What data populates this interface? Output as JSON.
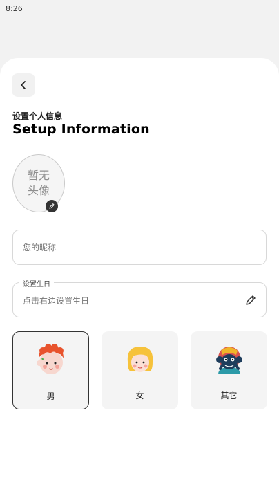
{
  "status_bar": {
    "time": "8:26"
  },
  "header": {
    "subtitle": "设置个人信息",
    "title": "Setup Information"
  },
  "avatar": {
    "placeholder_line1": "暂无",
    "placeholder_line2": "头像"
  },
  "nickname": {
    "placeholder": "您的昵称",
    "value": ""
  },
  "birthday": {
    "legend": "设置生日",
    "placeholder": "点击右边设置生日"
  },
  "gender": {
    "selected": "male",
    "options": [
      {
        "id": "male",
        "label": "男"
      },
      {
        "id": "female",
        "label": "女"
      },
      {
        "id": "other",
        "label": "其它"
      }
    ]
  },
  "icons": {
    "back": "chevron-left-icon",
    "avatar_edit": "pencil-icon",
    "birthday_edit": "pencil-icon"
  },
  "colors": {
    "sheet_background": "#ffffff",
    "page_background": "#f2f2f2",
    "card_background": "#f4f4f4",
    "selected_border": "#333333",
    "field_border": "#d8d8d8"
  }
}
